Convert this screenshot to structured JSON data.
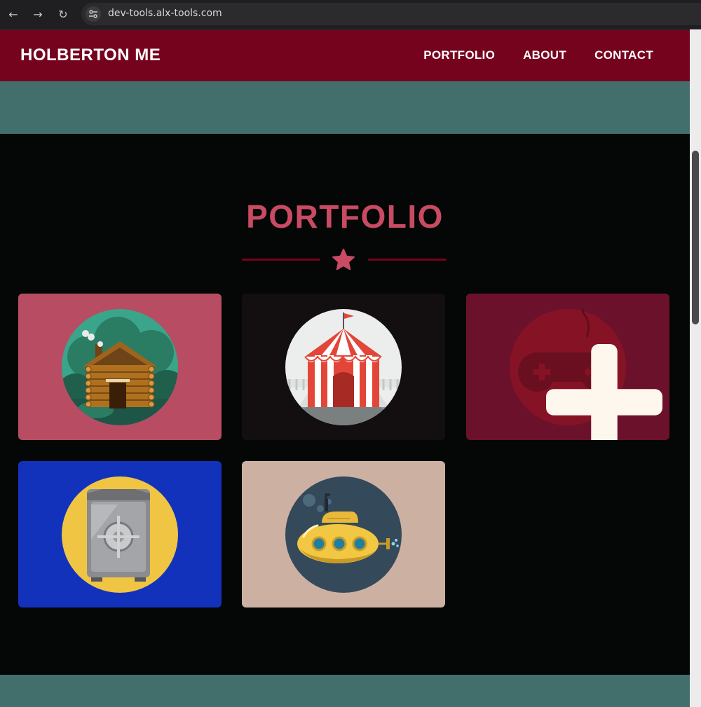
{
  "browser": {
    "url": "dev-tools.alx-tools.com",
    "back_icon": "arrow-left-icon",
    "forward_icon": "arrow-right-icon",
    "reload_icon": "reload-icon"
  },
  "navbar": {
    "brand": "HOLBERTON ME",
    "links": [
      "PORTFOLIO",
      "ABOUT",
      "CONTACT"
    ]
  },
  "portfolio": {
    "title": "PORTFOLIO",
    "divider_icon": "star-icon",
    "items": [
      {
        "icon": "cabin-icon",
        "bg": "#b84c63"
      },
      {
        "icon": "circus-tent-icon",
        "bg": "#130f10"
      },
      {
        "icon": "game-controller-icon",
        "bg": "#6c112c"
      },
      {
        "icon": "safe-icon",
        "bg": "#1232bb"
      },
      {
        "icon": "submarine-icon",
        "bg": "#ccb1a3"
      }
    ]
  },
  "colors": {
    "navbar": "#75031e",
    "accent": "#c94b63",
    "teal_band": "#426e6c",
    "page_bg": "#050606"
  }
}
